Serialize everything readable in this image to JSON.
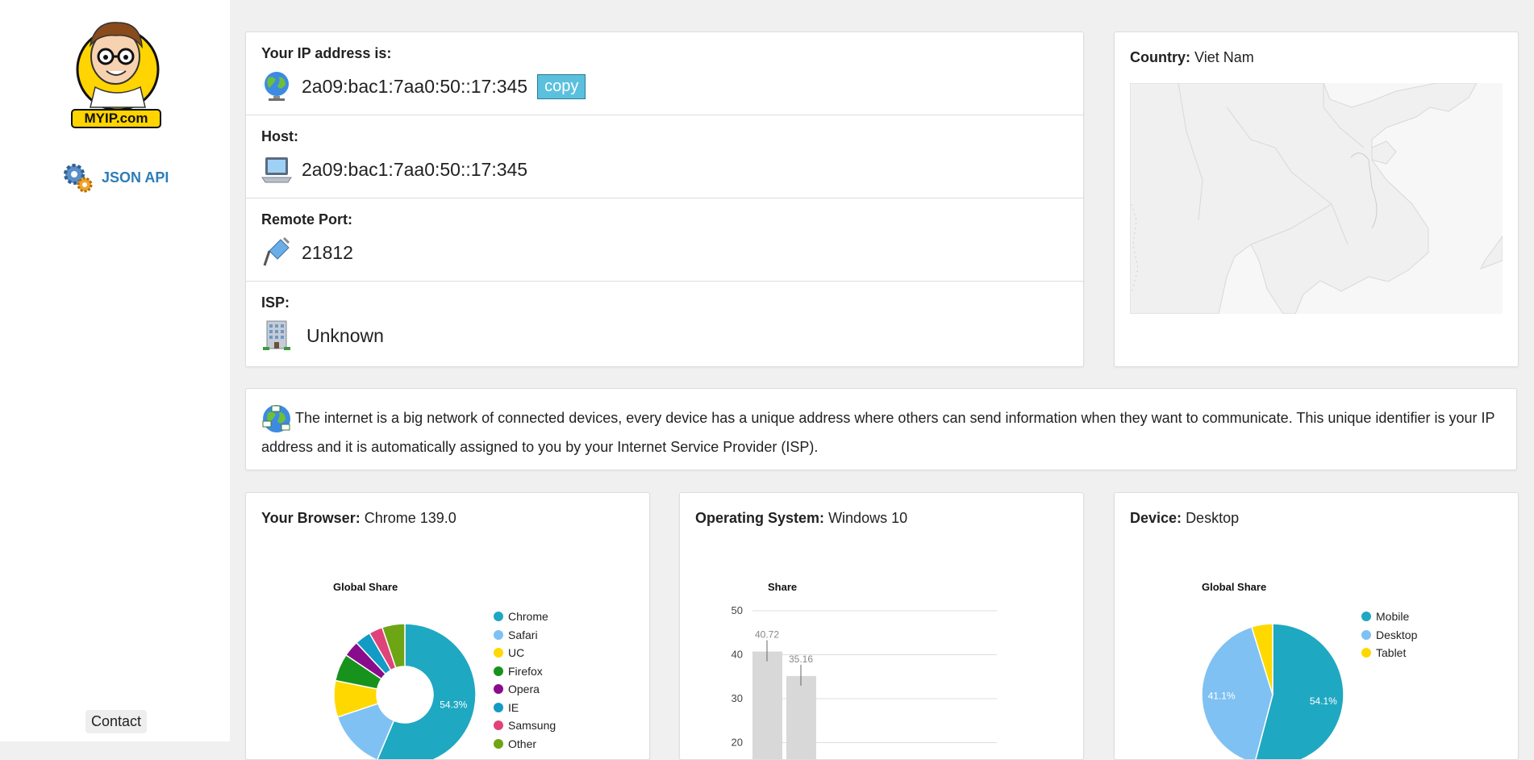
{
  "sidebar": {
    "logo_text": "MYIP.com",
    "api_label": "JSON API",
    "contact_label": "Contact"
  },
  "ip": {
    "label": "Your IP address is:",
    "value": "2a09:bac1:7aa0:50::17:345",
    "copy_label": "copy"
  },
  "host": {
    "label": "Host:",
    "value": "2a09:bac1:7aa0:50::17:345"
  },
  "port": {
    "label": "Remote Port:",
    "value": "21812"
  },
  "isp": {
    "label": "ISP:",
    "value": "Unknown"
  },
  "country": {
    "label": "Country:",
    "value": "Viet Nam"
  },
  "info": {
    "text": "The internet is a big network of connected devices, every device has a unique address where others can send information when they want to communicate. This unique identifier is your IP address and it is automatically assigned to you by your Internet Service Provider (ISP)."
  },
  "browser": {
    "label": "Your Browser:",
    "value": "Chrome 139.0"
  },
  "os": {
    "label": "Operating System:",
    "value": "Windows 10"
  },
  "device": {
    "label": "Device:",
    "value": "Desktop"
  },
  "chart_data": [
    {
      "type": "pie",
      "title": "Global Share",
      "categories": [
        "Chrome",
        "Safari",
        "UC",
        "Firefox",
        "Opera",
        "IE",
        "Samsung",
        "Other"
      ],
      "values": [
        54.3,
        13,
        8,
        6,
        3.5,
        3.5,
        3,
        5
      ],
      "colors": [
        "#1fa8c1",
        "#7fc1f2",
        "#ffd800",
        "#17931d",
        "#890c8c",
        "#129bc5",
        "#e0437a",
        "#6da514"
      ],
      "data_labels": [
        "54.3%"
      ],
      "legend": "right"
    },
    {
      "type": "bar",
      "title": "Share",
      "values": [
        40.72,
        35.16
      ],
      "ylim": [
        20,
        50
      ],
      "yticks": [
        20,
        30,
        40,
        50
      ],
      "color": "#d8d8d8"
    },
    {
      "type": "pie",
      "title": "Global Share",
      "categories": [
        "Mobile",
        "Desktop",
        "Tablet"
      ],
      "values": [
        54.1,
        41.1,
        4.8
      ],
      "colors": [
        "#1fa8c1",
        "#7fc1f2",
        "#ffd800"
      ],
      "data_labels": [
        "54.1%",
        "41.1%"
      ],
      "legend": "right"
    }
  ]
}
